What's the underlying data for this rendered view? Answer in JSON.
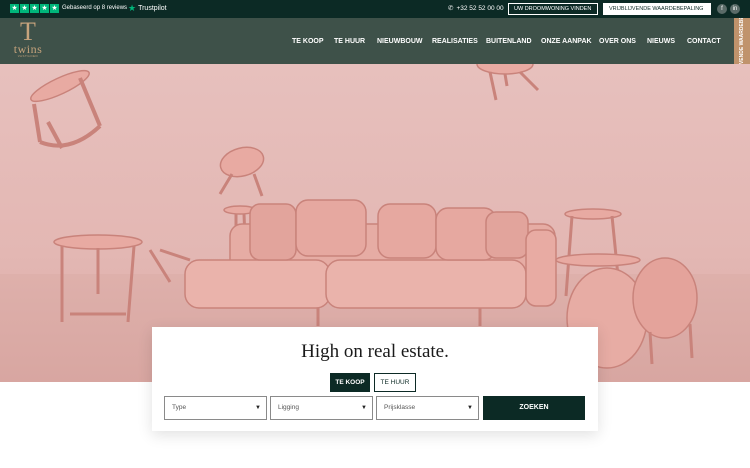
{
  "topbar": {
    "trustpilot_text": "Gebaseerd op 8 reviews",
    "trustpilot_brand": "Trustpilot",
    "phone": "+32 52 52 00 00",
    "dream_button": "UW DROOMWONING VINDEN",
    "valuation_button": "VRIJBLIJVENDE WAARDEBEPALING",
    "social": [
      "f",
      "in"
    ]
  },
  "logo": {
    "letter": "T",
    "word": "twins",
    "sub": "VASTGOED"
  },
  "nav": [
    "TE KOOP",
    "TE HUUR",
    "NIEUWBOUW",
    "REALISATIES",
    "BUITENLAND",
    "ONZE AANPAK",
    "OVER ONS",
    "NIEUWS",
    "CONTACT"
  ],
  "side_tab": "VRIJBLIJVENDE WAARDEBEPALING",
  "search": {
    "title": "High on real estate.",
    "tab_buy": "TE KOOP",
    "tab_rent": "TE HUUR",
    "type_placeholder": "Type",
    "location_placeholder": "Ligging",
    "price_placeholder": "Prijsklasse",
    "submit": "ZOEKEN"
  },
  "colors": {
    "dark_green": "#0c2a25",
    "nav_green": "#3e5149",
    "gold": "#c7a47d",
    "trustpilot": "#00b67a",
    "pink": "#e3b7b3"
  }
}
